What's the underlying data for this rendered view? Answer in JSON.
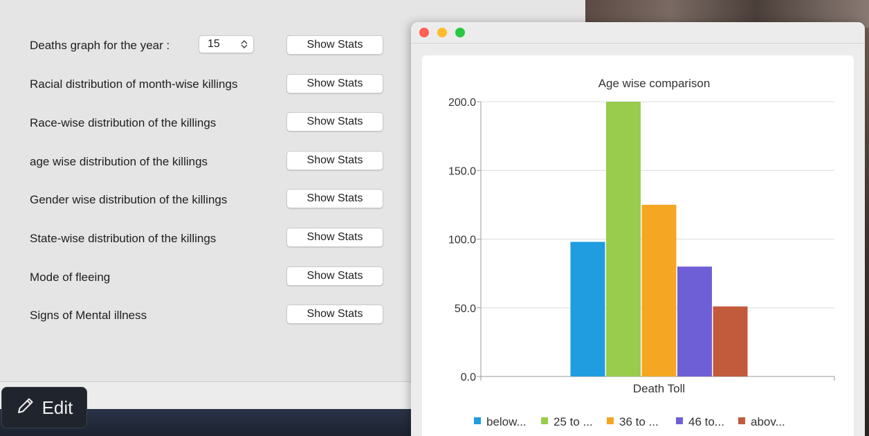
{
  "main": {
    "rows": [
      {
        "label": "Deaths graph for the year :",
        "button": "Show Stats"
      },
      {
        "label": "Racial distribution of month-wise killings",
        "button": "Show Stats"
      },
      {
        "label": "Race-wise distribution of the killings",
        "button": "Show Stats"
      },
      {
        "label": "age wise distribution of the killings",
        "button": "Show Stats"
      },
      {
        "label": "Gender wise distribution of the killings",
        "button": "Show Stats"
      },
      {
        "label": "State-wise distribution of the killings",
        "button": "Show Stats"
      },
      {
        "label": "Mode of fleeing",
        "button": "Show Stats"
      },
      {
        "label": "Signs of Mental illness",
        "button": "Show Stats"
      }
    ],
    "year_spinner": {
      "value": "15"
    }
  },
  "edit_button": {
    "label": "Edit",
    "icon": "pencil-icon"
  },
  "window_controls": {
    "close": "#ff5f57",
    "minimize": "#febc2e",
    "zoom": "#28c840"
  },
  "chart_data": {
    "type": "bar",
    "title": "Age wise comparison",
    "categories": [
      "Death Toll"
    ],
    "series": [
      {
        "name": "below...",
        "values": [
          98
        ],
        "color": "#1f9de0"
      },
      {
        "name": "25 to ...",
        "values": [
          200
        ],
        "color": "#99cc4c"
      },
      {
        "name": "36 to ...",
        "values": [
          125
        ],
        "color": "#f5a623"
      },
      {
        "name": "46 to...",
        "values": [
          80
        ],
        "color": "#6f5fd6"
      },
      {
        "name": "abov...",
        "values": [
          51
        ],
        "color": "#c25a3c"
      }
    ],
    "ylim": [
      0,
      200
    ],
    "yticks": [
      "0.0",
      "50.0",
      "100.0",
      "150.0",
      "200.0"
    ],
    "ytick_values": [
      0,
      50,
      100,
      150,
      200
    ],
    "grid": true,
    "legend": "bottom"
  }
}
